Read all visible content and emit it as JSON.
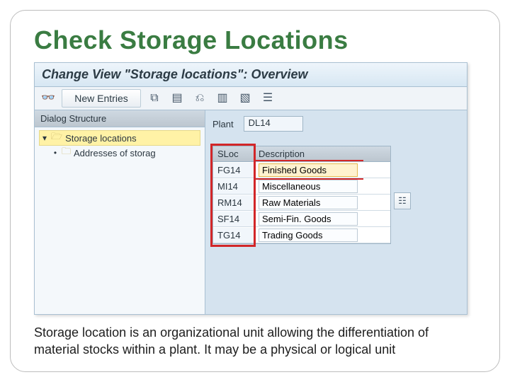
{
  "slide": {
    "title": "Check Storage Locations",
    "caption": "Storage location is an organizational unit allowing the differentiation of material stocks within a plant. It may be a physical or logical unit"
  },
  "sap": {
    "window_title": "Change View \"Storage locations\": Overview",
    "toolbar": {
      "new_entries": "New Entries",
      "icons": [
        "glasses",
        "copy",
        "save",
        "undo",
        "page-del",
        "page-ok",
        "page-lines"
      ]
    },
    "tree": {
      "header": "Dialog Structure",
      "node1": "Storage locations",
      "node2": "Addresses of storag"
    },
    "plant": {
      "label": "Plant",
      "value": "DL14"
    },
    "table": {
      "col1": "SLoc",
      "col2": "Description",
      "rows": [
        {
          "sloc": "FG14",
          "desc": "Finished Goods"
        },
        {
          "sloc": "MI14",
          "desc": "Miscellaneous"
        },
        {
          "sloc": "RM14",
          "desc": "Raw Materials"
        },
        {
          "sloc": "SF14",
          "desc": "Semi-Fin. Goods"
        },
        {
          "sloc": "TG14",
          "desc": "Trading Goods"
        }
      ]
    }
  }
}
